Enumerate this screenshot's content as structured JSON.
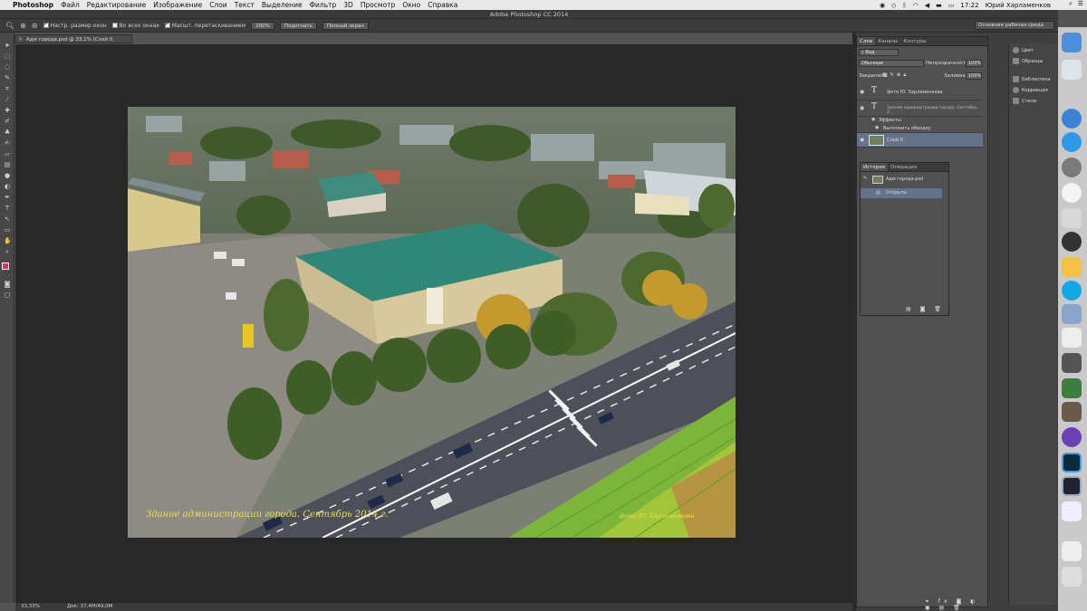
{
  "menubar": {
    "app_name": "Photoshop",
    "items": [
      "Файл",
      "Редактирование",
      "Изображение",
      "Слои",
      "Текст",
      "Выделение",
      "Фильтр",
      "3D",
      "Просмотр",
      "Окно",
      "Справка"
    ],
    "time": "17:22",
    "user": "Юрий Харламенков"
  },
  "window": {
    "title": "Adobe Photoshop CC 2014"
  },
  "options": {
    "check1": "Настр. размер окон",
    "check2": "Во всех окнах",
    "check3": "Масшт. перетаскиванием",
    "zoom_btn": "100%",
    "fit_btn": "Подогнать",
    "full_btn": "Полный экран",
    "workspace": "Основная рабочая среда"
  },
  "document": {
    "tab_title": "Адм города.psd @ 33,1% (Слой 0, RGB/8*)",
    "caption_left": "Здание администрации города. Сентябрь 2014 г.",
    "caption_right": "фото Ю. Харламенкова"
  },
  "statusbar": {
    "zoom": "33,33%",
    "doc": "Док: 37,4M/49,0M"
  },
  "layers_panel": {
    "tabs": [
      "Слои",
      "Каналы",
      "Контуры"
    ],
    "kind": "Вид",
    "blend": "Обычные",
    "opacity_label": "Непрозрачность:",
    "opacity": "100%",
    "lock_label": "Закрепить:",
    "fill_label": "Заливка:",
    "fill": "100%",
    "layers": [
      {
        "name": "фото Ю. Харламенкова"
      },
      {
        "name": "Здание администрации города. Сентябрь 2..."
      },
      {
        "name": "Эффекты"
      },
      {
        "name": "Выполнить обводку"
      },
      {
        "name": "Слой 0"
      }
    ]
  },
  "history_panel": {
    "tabs": [
      "История",
      "Операции"
    ],
    "snapshot": "Адм города.psd",
    "items": [
      "Открыть"
    ]
  },
  "side_panel": {
    "items": [
      "Цвет",
      "Образцы",
      "Библиотеки",
      "Коррекция",
      "Стили"
    ]
  },
  "colors": {
    "accent_yellow": "#e8e04a",
    "selected_layer": "#64728a",
    "dock_bg": "#c9c9c9"
  }
}
